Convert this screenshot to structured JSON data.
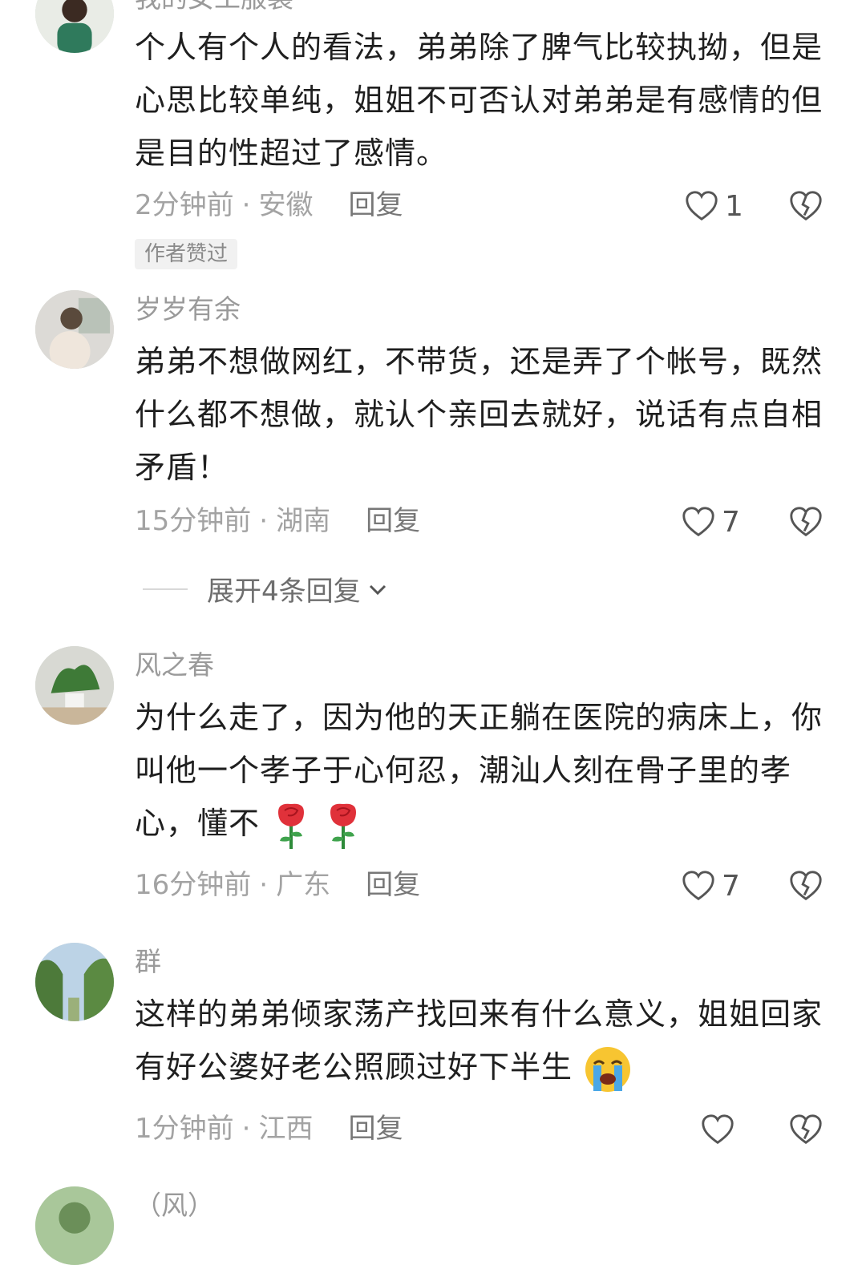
{
  "comments": [
    {
      "username": "我的女工服装",
      "text": "个人有个人的看法，弟弟除了脾气比较执拗，但是心思比较单纯，姐姐不可否认对弟弟是有感情的但是目的性超过了感情。",
      "time": "2分钟前",
      "location": "安徽",
      "reply": "回复",
      "likes": "1",
      "badge": "作者赞过"
    },
    {
      "username": "岁岁有余",
      "text": "弟弟不想做网红，不带货，还是弄了个帐号，既然什么都不想做，就认个亲回去就好，说话有点自相矛盾！",
      "time": "15分钟前",
      "location": "湖南",
      "reply": "回复",
      "likes": "7",
      "expand": "展开4条回复"
    },
    {
      "username": "风之春",
      "text": "为什么走了，因为他的天正躺在医院的病床上，你叫他一个孝子于心何忍，潮汕人刻在骨子里的孝心，懂不",
      "time": "16分钟前",
      "location": "广东",
      "reply": "回复",
      "likes": "7"
    },
    {
      "username": "群",
      "text": "这样的弟弟倾家荡产找回来有什么意义，姐姐回家有好公婆好老公照顾过好下半生",
      "time": "1分钟前",
      "location": "江西",
      "reply": "回复",
      "likes": ""
    },
    {
      "username": "（风）"
    }
  ],
  "icons": {
    "like": "heart-outline-icon",
    "dislike": "broken-heart-icon",
    "expand": "chevron-down-icon",
    "rose": "rose-emoji",
    "cry": "loudly-crying-face-emoji"
  },
  "colors": {
    "text": "#1f1f1f",
    "meta": "#a3a3a3",
    "badge_bg": "#f1f1f1"
  }
}
